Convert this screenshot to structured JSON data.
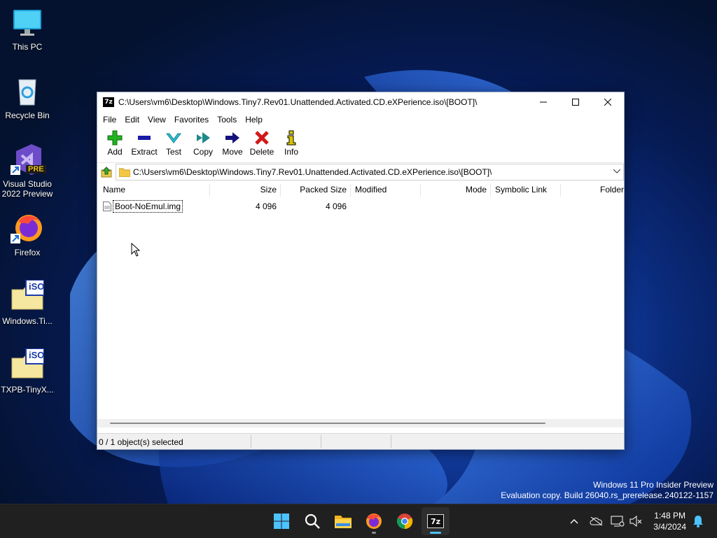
{
  "desktop": {
    "icons": [
      {
        "label": "This PC"
      },
      {
        "label": "Recycle Bin"
      },
      {
        "label": "Visual Studio 2022 Preview",
        "badge": "PRE"
      },
      {
        "label": "Firefox"
      },
      {
        "label": "Windows.Ti...",
        "badge": "iSO"
      },
      {
        "label": "TXPB-TinyX...",
        "badge": "iSO"
      }
    ]
  },
  "window": {
    "logo": "7z",
    "title": "C:\\Users\\vm6\\Desktop\\Windows.Tiny7.Rev01.Unattended.Activated.CD.eXPerience.iso\\[BOOT]\\",
    "menu": [
      "File",
      "Edit",
      "View",
      "Favorites",
      "Tools",
      "Help"
    ],
    "toolbar": [
      {
        "label": "Add",
        "icon": "plus-icon",
        "color": "#21b321"
      },
      {
        "label": "Extract",
        "icon": "minus-icon",
        "color": "#1a1aa8"
      },
      {
        "label": "Test",
        "icon": "check-icon",
        "color": "#2cc0d8"
      },
      {
        "label": "Copy",
        "icon": "double-arrow-icon",
        "color": "#1e8a8a"
      },
      {
        "label": "Move",
        "icon": "arrow-icon",
        "color": "#12127a"
      },
      {
        "label": "Delete",
        "icon": "x-icon",
        "color": "#d01818"
      },
      {
        "label": "Info",
        "icon": "info-icon",
        "color": "#d8c800"
      }
    ],
    "address": "C:\\Users\\vm6\\Desktop\\Windows.Tiny7.Rev01.Unattended.Activated.CD.eXPerience.iso\\[BOOT]\\",
    "columns": {
      "name": "Name",
      "size": "Size",
      "packed": "Packed Size",
      "modified": "Modified",
      "mode": "Mode",
      "symlink": "Symbolic Link",
      "folder": "Folder"
    },
    "files": [
      {
        "name": "Boot-NoEmul.img",
        "size": "4 096",
        "packed": "4 096"
      }
    ],
    "status": "0 / 1 object(s) selected"
  },
  "watermark": {
    "line1": "Windows 11 Pro Insider Preview",
    "line2": "Evaluation copy. Build 26040.rs_prerelease.240122-1157"
  },
  "taskbar": {
    "time": "1:48 PM",
    "date": "3/4/2024",
    "active_app": "7-Zip File Manager",
    "accent": "#4cc2ff"
  }
}
